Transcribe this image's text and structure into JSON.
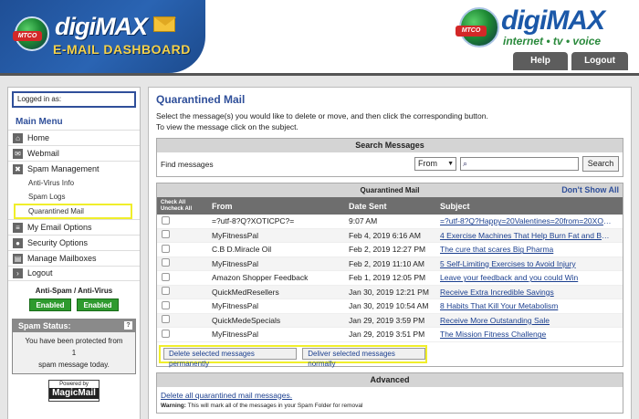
{
  "header": {
    "logo_mtco": "MTCO",
    "logo_title_a": "digi",
    "logo_title_b": "MAX",
    "logo_subtitle": "E-MAIL DASHBOARD",
    "brand_mtco": "MTCO",
    "brand_name": "digiMAX",
    "brand_tagline": "internet • tv • voice",
    "tabs": [
      {
        "label": "Help"
      },
      {
        "label": "Logout"
      }
    ]
  },
  "sidebar": {
    "logged_in_label": "Logged in as:",
    "main_menu_title": "Main Menu",
    "items": [
      {
        "label": "Home",
        "icon": "home-icon"
      },
      {
        "label": "Webmail",
        "icon": "mail-icon"
      },
      {
        "label": "Spam Management",
        "icon": "spam-icon"
      },
      {
        "label": "My Email Options",
        "icon": "options-icon"
      },
      {
        "label": "Security Options",
        "icon": "lock-icon"
      },
      {
        "label": "Manage Mailboxes",
        "icon": "mailbox-icon"
      },
      {
        "label": "Logout",
        "icon": "logout-icon"
      }
    ],
    "sub_items": [
      {
        "label": "Anti-Virus Info"
      },
      {
        "label": "Spam Logs"
      },
      {
        "label": "Quarantined Mail"
      }
    ],
    "antispam_title": "Anti-Spam / Anti-Virus",
    "antispam_status": "Enabled",
    "antivirus_status": "Enabled",
    "spam_status_title": "Spam Status:",
    "spam_status_help": "?",
    "spam_status_line1": "You have been protected from",
    "spam_status_count": "1",
    "spam_status_line2": "spam message today.",
    "powered_by": "Powered by",
    "powered_name": "MagicMail"
  },
  "main": {
    "title": "Quarantined Mail",
    "instruction_1": "Select the message(s) you would like to delete or move, and then click the corresponding button.",
    "instruction_2": "To view the message click on the subject.",
    "search": {
      "header": "Search Messages",
      "label": "Find messages",
      "field_select": "From",
      "button": "Search"
    },
    "quarantine": {
      "header": "Quarantined Mail",
      "dont_show_all": "Don't Show All",
      "check_all": "Check All",
      "uncheck_all": "Uncheck All",
      "col_from": "From",
      "col_date": "Date Sent",
      "col_subject": "Subject",
      "rows": [
        {
          "from": "=?utf-8?Q?XOTICPC?=",
          "date": "9:07 AM",
          "subject": "=?utf-8?Q?Happy=20Valentines=20from=20XOTI..."
        },
        {
          "from": "MyFitnessPal",
          "date": "Feb 4, 2019 6:16 AM",
          "subject": "4 Exercise Machines That Help Burn Fat and Buil..."
        },
        {
          "from": "C.B D.Miracle Oil",
          "date": "Feb 2, 2019 12:27 PM",
          "subject": "The cure that scares Big Pharma"
        },
        {
          "from": "MyFitnessPal",
          "date": "Feb 2, 2019 11:10 AM",
          "subject": "5 Self-Limiting Exercises to Avoid Injury"
        },
        {
          "from": "Amazon Shopper Feedback",
          "date": "Feb 1, 2019 12:05 PM",
          "subject": "Leave your feedback and you could Win"
        },
        {
          "from": "QuickMedResellers",
          "date": "Jan 30, 2019 12:21 PM",
          "subject": "Receive Extra Incredible Savings"
        },
        {
          "from": "MyFitnessPal",
          "date": "Jan 30, 2019 10:54 AM",
          "subject": "8 Habits That Kill Your Metabolism"
        },
        {
          "from": "QuickMedeSpecials",
          "date": "Jan 29, 2019 3:59 PM",
          "subject": "Receive More Outstanding Sale"
        },
        {
          "from": "MyFitnessPal",
          "date": "Jan 29, 2019 3:51 PM",
          "subject": "The Mission Fitness Challenge"
        }
      ],
      "delete_button": "Delete selected messages permanently",
      "deliver_button": "Deliver selected messages normally"
    },
    "advanced": {
      "header": "Advanced",
      "delete_all_link": "Delete all quarantined mail messages.",
      "warning_label": "Warning:",
      "warning_text": " This will mark all of the messages in your Spam Folder for removal"
    }
  }
}
